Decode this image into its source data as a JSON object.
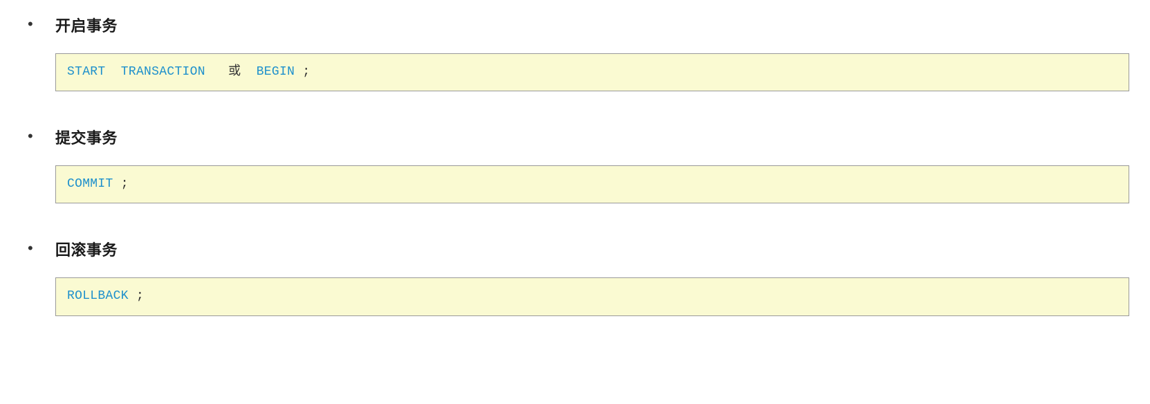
{
  "sections": [
    {
      "heading": "开启事务",
      "code_tokens": [
        {
          "type": "kw",
          "text": "START"
        },
        {
          "type": "space",
          "text": "  "
        },
        {
          "type": "kw",
          "text": "TRANSACTION"
        },
        {
          "type": "space",
          "text": "   "
        },
        {
          "type": "plain",
          "text": "或"
        },
        {
          "type": "space",
          "text": "  "
        },
        {
          "type": "kw",
          "text": "BEGIN"
        },
        {
          "type": "space",
          "text": " "
        },
        {
          "type": "plain",
          "text": ";"
        }
      ]
    },
    {
      "heading": "提交事务",
      "code_tokens": [
        {
          "type": "kw",
          "text": "COMMIT"
        },
        {
          "type": "space",
          "text": " "
        },
        {
          "type": "plain",
          "text": ";"
        }
      ]
    },
    {
      "heading": "回滚事务",
      "code_tokens": [
        {
          "type": "kw",
          "text": "ROLLBACK"
        },
        {
          "type": "space",
          "text": " "
        },
        {
          "type": "plain",
          "text": ";"
        }
      ]
    }
  ]
}
